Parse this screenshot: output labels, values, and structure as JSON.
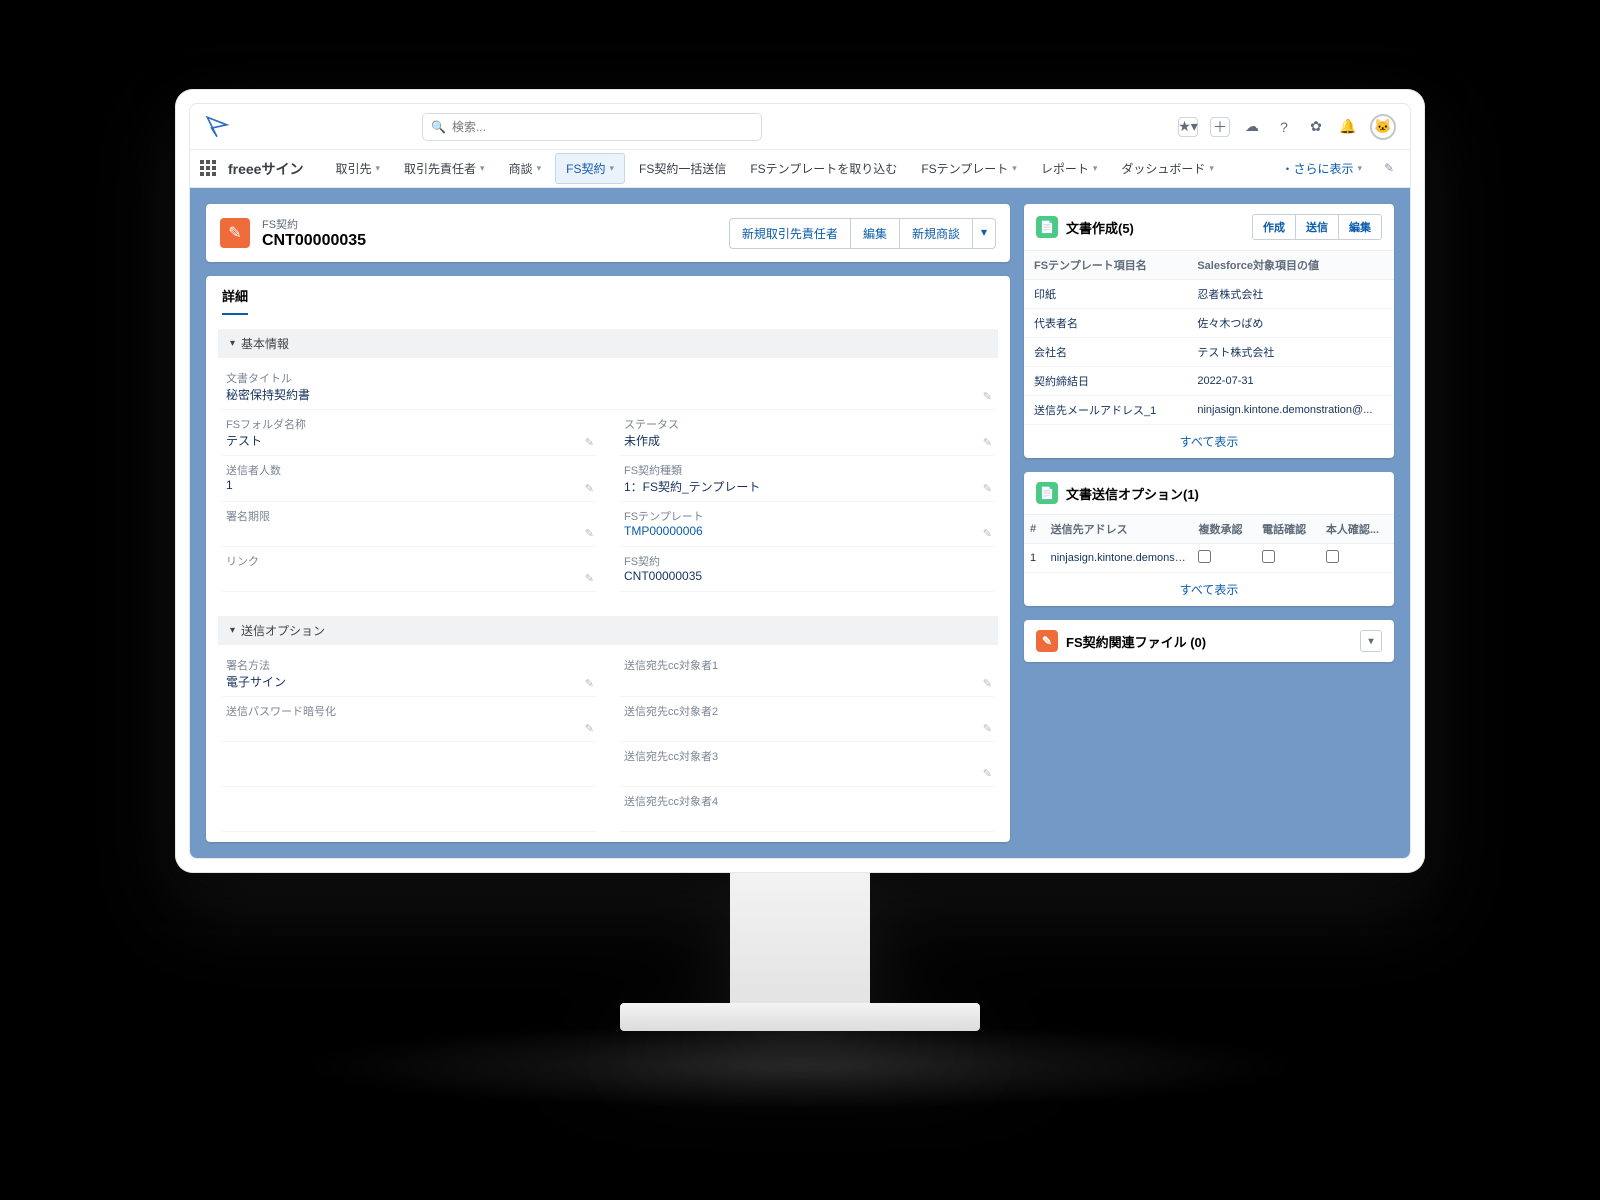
{
  "search_placeholder": "検索...",
  "app_name": "freeeサイン",
  "nav": {
    "items": [
      "取引先",
      "取引先責任者",
      "商談",
      "FS契約",
      "FS契約一括送信",
      "FSテンプレートを取り込む",
      "FSテンプレート",
      "レポート",
      "ダッシュボード"
    ],
    "more": "・さらに表示"
  },
  "record": {
    "object_label": "FS契約",
    "name": "CNT00000035",
    "actions": [
      "新規取引先責任者",
      "編集",
      "新規商談"
    ]
  },
  "tab_detail": "詳細",
  "sections": {
    "basic": {
      "title": "基本情報",
      "fields": {
        "doc_title_lbl": "文書タイトル",
        "doc_title_val": "秘密保持契約書",
        "folder_lbl": "FSフォルダ名称",
        "folder_val": "テスト",
        "status_lbl": "ステータス",
        "status_val": "未作成",
        "sendcount_lbl": "送信者人数",
        "sendcount_val": "1",
        "template_type_lbl": "FS契約種類",
        "template_type_val": "1：FS契約_テンプレート",
        "sign_deadline_lbl": "署名期限",
        "sign_deadline_val": "",
        "fstemplate_lbl": "FSテンプレート",
        "fstemplate_val": "TMP00000006",
        "link_lbl": "リンク",
        "link_val": "",
        "fscontract_lbl": "FS契約",
        "fscontract_val": "CNT00000035"
      }
    },
    "send": {
      "title": "送信オプション",
      "fields": {
        "sign_method_lbl": "署名方法",
        "sign_method_val": "電子サイン",
        "cc1_lbl": "送信宛先cc対象者1",
        "pw_lbl": "送信パスワード暗号化",
        "pw_val": "",
        "cc2_lbl": "送信宛先cc対象者2",
        "cc3_lbl": "送信宛先cc対象者3",
        "cc4_lbl": "送信宛先cc対象者4"
      }
    }
  },
  "side": {
    "doc_create": {
      "title": "文書作成(5)",
      "actions": [
        "作成",
        "送信",
        "編集"
      ],
      "th1": "FSテンプレート項目名",
      "th2": "Salesforce対象項目の値",
      "rows": [
        {
          "k": "印紙",
          "v": "忍者株式会社"
        },
        {
          "k": "代表者名",
          "v": "佐々木つばめ"
        },
        {
          "k": "会社名",
          "v": "テスト株式会社"
        },
        {
          "k": "契約締結日",
          "v": "2022-07-31"
        },
        {
          "k": "送信先メールアドレス_1",
          "v": "ninjasign.kintone.demonstration@..."
        }
      ],
      "view_all": "すべて表示"
    },
    "doc_send": {
      "title": "文書送信オプション(1)",
      "th_num": "#",
      "th_addr": "送信先アドレス",
      "th_multi": "複数承認",
      "th_tel": "電話確認",
      "th_id": "本人確認...",
      "rows": [
        {
          "n": "1",
          "addr": "ninjasign.kintone.demonstratio..."
        }
      ],
      "view_all": "すべて表示"
    },
    "files": {
      "title": "FS契約関連ファイル (0)"
    }
  }
}
